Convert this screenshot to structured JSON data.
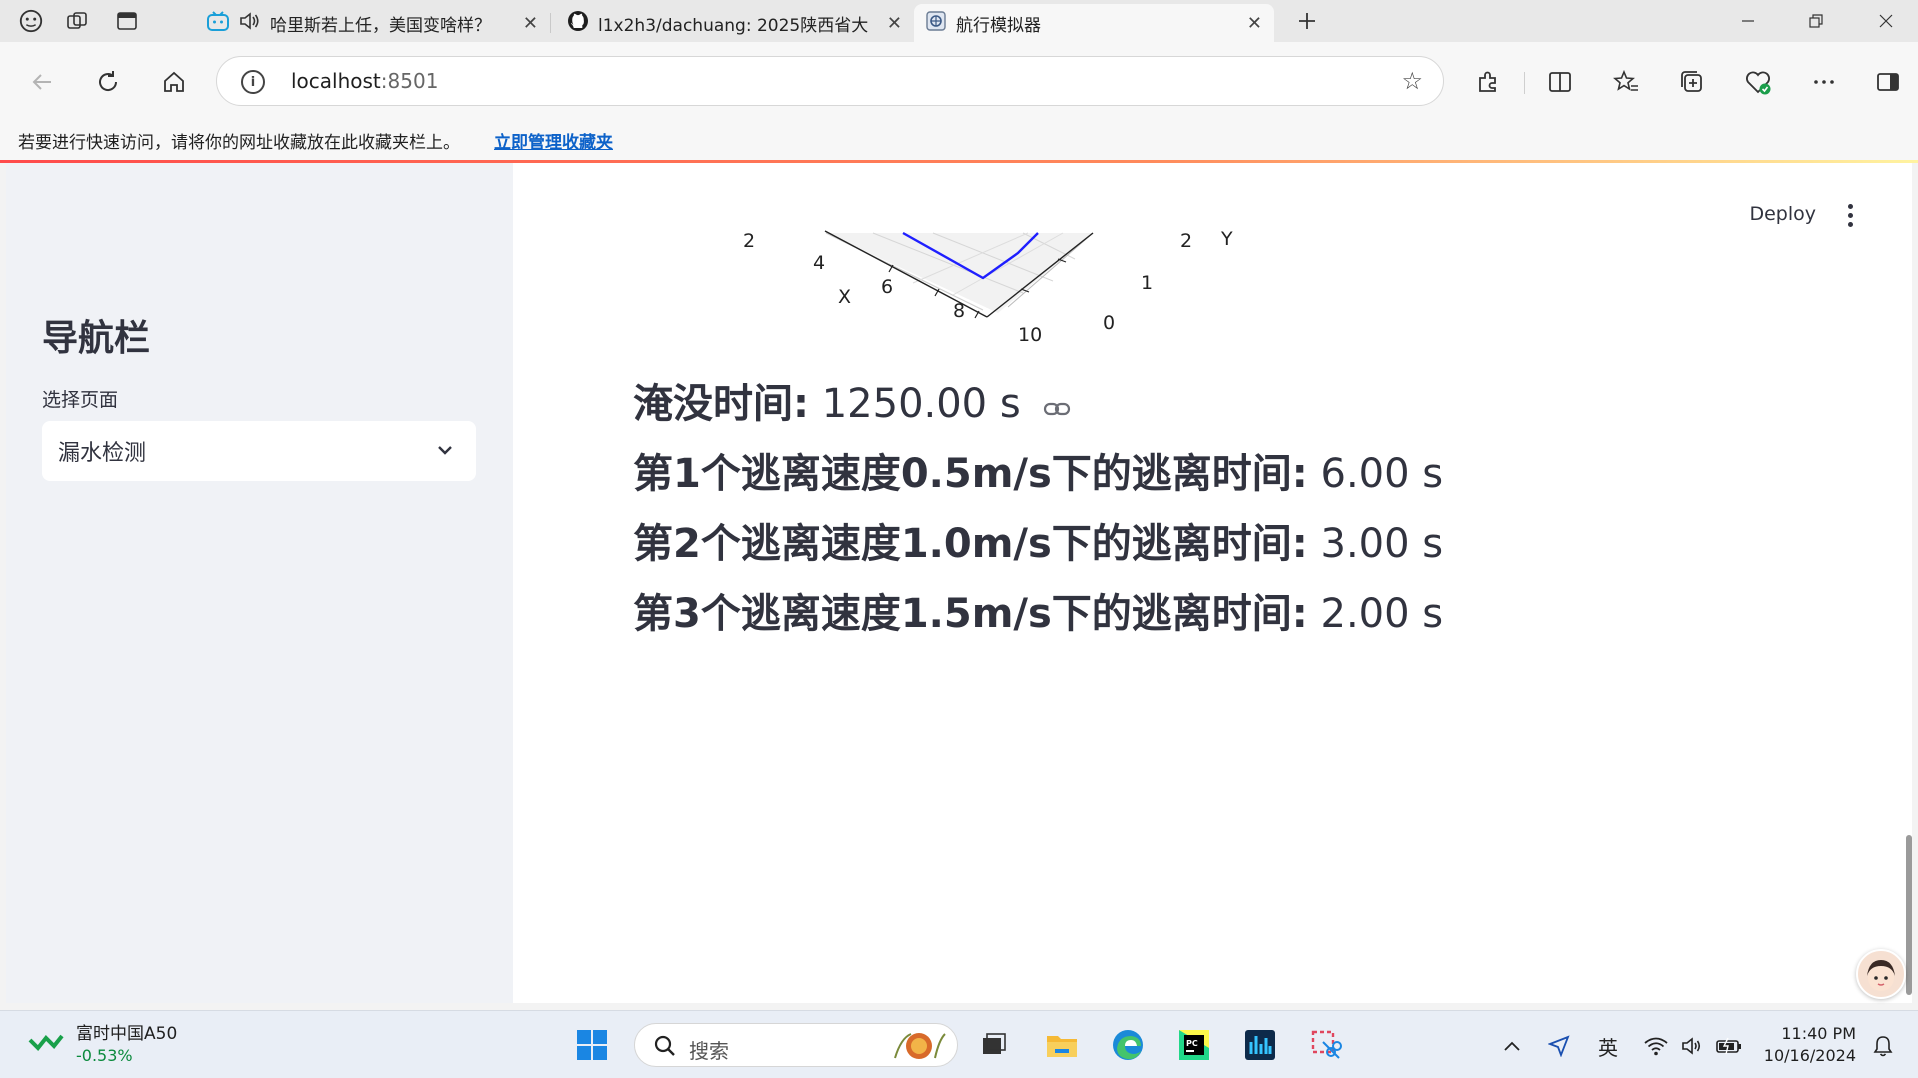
{
  "browser": {
    "tabs": [
      {
        "title": "哈里斯若上任，美国变啥样？",
        "icon": "bilibili-icon",
        "muted_icon": "speaker-icon"
      },
      {
        "title": "l1x2h3/dachuang: 2025陕西省大创",
        "icon": "github-icon"
      },
      {
        "title": "航行模拟器",
        "icon": "streamlit-page-icon",
        "active": true
      }
    ],
    "address": {
      "host": "localhost",
      "port": ":8501"
    },
    "favorites_hint": "若要进行快速访问，请将你的网址收藏放在此收藏夹栏上。",
    "favorites_link": "立即管理收藏夹"
  },
  "sidebar": {
    "title": "导航栏",
    "select_label": "选择页面",
    "select_value": "漏水检测"
  },
  "header": {
    "deploy_label": "Deploy"
  },
  "plot3d": {
    "x_axis_label": "X",
    "y_axis_label": "Y",
    "x_ticks": [
      "2",
      "4",
      "6",
      "8",
      "10"
    ],
    "y_ticks": [
      "2",
      "1",
      "0"
    ],
    "line_color": "#1f1fff"
  },
  "metrics": [
    {
      "label": "淹没时间:",
      "value": " 1250.00 s"
    },
    {
      "label": "第1个逃离速度0.5m/s下的逃离时间:",
      "value": " 6.00 s"
    },
    {
      "label": "第2个逃离速度1.0m/s下的逃离时间:",
      "value": " 3.00 s"
    },
    {
      "label": "第3个逃离速度1.5m/s下的逃离时间:",
      "value": " 2.00 s"
    }
  ],
  "taskbar": {
    "stock_name": "富时中国A50",
    "stock_change": "-0.53%",
    "search_placeholder": "搜索",
    "ime": "英",
    "time": "11:40 PM",
    "date": "10/16/2024"
  }
}
